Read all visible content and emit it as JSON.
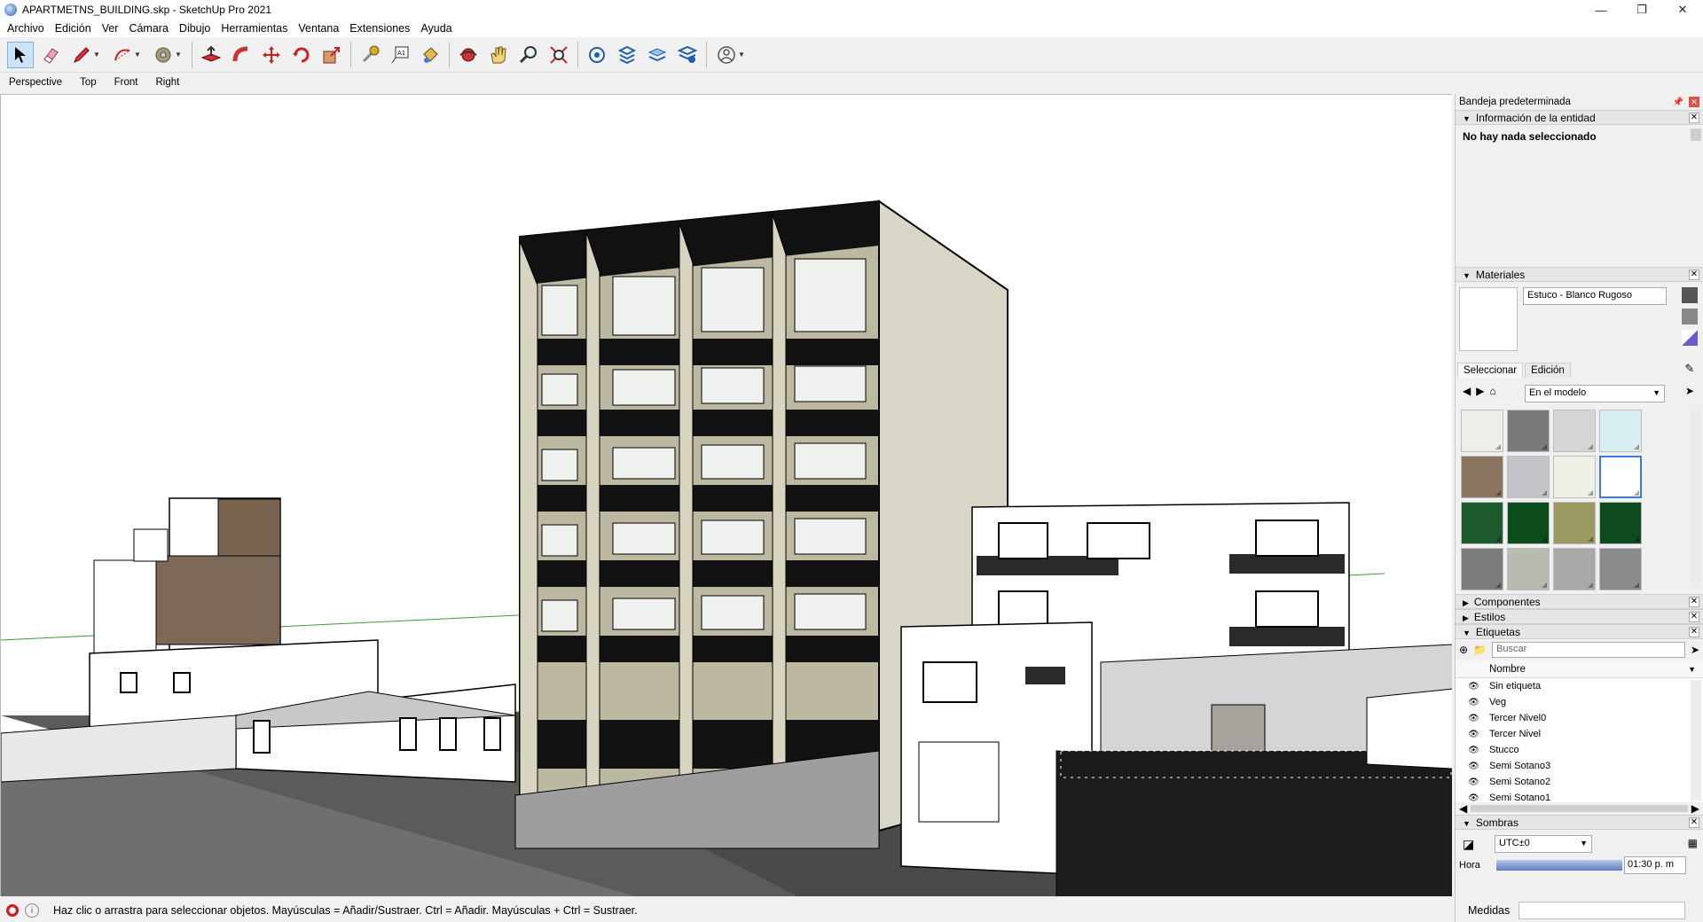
{
  "window": {
    "title": "APARTMETNS_BUILDING.skp - SketchUp Pro 2021",
    "controls": [
      "minimize",
      "restore",
      "close"
    ]
  },
  "menu": [
    "Archivo",
    "Edición",
    "Ver",
    "Cámara",
    "Dibujo",
    "Herramientas",
    "Ventana",
    "Extensiones",
    "Ayuda"
  ],
  "toolbar": {
    "tools": [
      "select-icon",
      "eraser-icon",
      "pencil-icon",
      "arc-icon",
      "tape-circle-icon",
      "push-pull-icon",
      "follow-me-icon",
      "move-icon",
      "rotate-icon",
      "scale-icon",
      "tape-measure-icon",
      "text-icon",
      "paint-bucket-icon",
      "orbit-icon",
      "pan-icon",
      "zoom-icon",
      "zoom-extents-icon",
      "warehouse-icon",
      "extension-warehouse-icon",
      "layout-icon",
      "extension-manager-icon",
      "account-icon"
    ]
  },
  "scenes": [
    "Perspective",
    "Top",
    "Front",
    "Right"
  ],
  "status": {
    "message": "Haz clic o arrastra para seleccionar objetos. Mayúsculas = Añadir/Sustraer. Ctrl = Añadir. Mayúsculas + Ctrl = Sustraer."
  },
  "measurements": {
    "label": "Medidas",
    "value": ""
  },
  "tray": {
    "title": "Bandeja predeterminada",
    "entity": {
      "header": "Información de la entidad",
      "message": "No hay nada seleccionado"
    },
    "materials": {
      "header": "Materiales",
      "current_name": "Estuco - Blanco Rugoso",
      "tabs": [
        "Seleccionar",
        "Edición"
      ],
      "collection": "En el modelo",
      "swatch_colors": [
        "#ededea",
        "#7a7a7a",
        "#d5d5d8",
        "#d9eef1",
        "#8a7560",
        "#c4c4c8",
        "#eff0e6",
        "#ffffff",
        "#1d5a2e",
        "#0b4d1a",
        "#9a9a62",
        "#0d4a1f",
        "#7b7b7b",
        "#b9bab2",
        "#a9aaa7",
        "#8b8b8e"
      ],
      "selected_swatch": 7
    },
    "collapsed_panels": [
      "Componentes",
      "Estilos"
    ],
    "tags": {
      "header": "Etiquetas",
      "search_placeholder": "Buscar",
      "column": "Nombre",
      "items": [
        "Sin etiqueta",
        "Veg",
        "Tercer Nivel0",
        "Tercer Nivel",
        "Stucco",
        "Semi Sotano3",
        "Semi Sotano2",
        "Semi Sotano1"
      ]
    },
    "shadows": {
      "header": "Sombras",
      "timezone": "UTC±0",
      "hour_label": "Hora",
      "time_value": "01:30 p. m"
    }
  }
}
